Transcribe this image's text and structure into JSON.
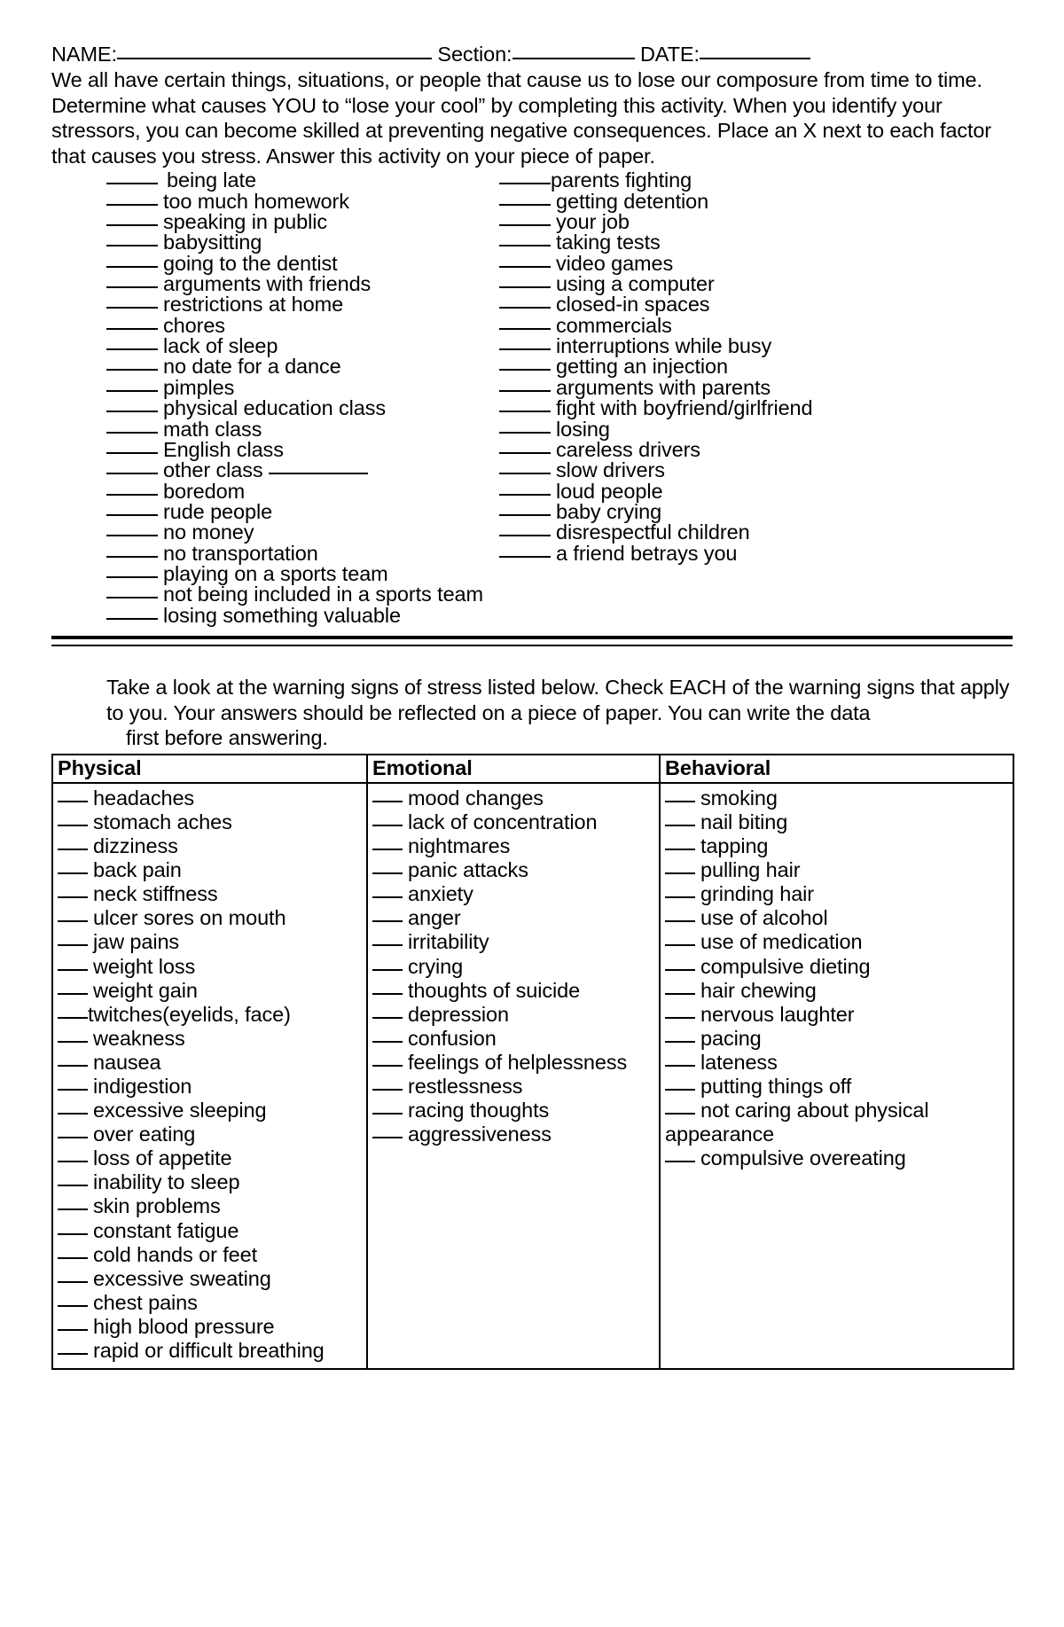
{
  "header": {
    "name_label": "NAME:",
    "section_label": "Section:",
    "date_label": "DATE:"
  },
  "intro": {
    "paragraph": "We all have certain things, situations, or people that cause us to lose our composure from time to time. Determine what causes YOU to “lose your cool” by completing this activity. When you identify your stressors, you can become skilled at preventing negative consequences. Place an X next to each factor that causes you stress. Answer this activity on your piece of paper."
  },
  "stressors": {
    "left_column": [
      "being late",
      "too much homework",
      "speaking in public",
      "babysitting",
      "going to the dentist",
      "arguments with friends",
      "restrictions at home",
      "chores",
      "lack of sleep",
      "no date for a dance",
      "pimples",
      "physical education class",
      "math class",
      "English class",
      "other class",
      "boredom",
      "rude people",
      "no money",
      "no transportation",
      "playing on a sports team",
      "not being included in a sports team",
      "losing something valuable"
    ],
    "right_column": [
      "parents fighting",
      "getting detention",
      "your job",
      "taking tests",
      "video games",
      "using a computer",
      "closed-in spaces",
      "commercials",
      "interruptions while busy",
      "getting an injection",
      "arguments with parents",
      "fight with boyfriend/girlfriend",
      "losing",
      "careless drivers",
      "slow drivers",
      "loud people",
      "baby crying",
      "disrespectful children",
      "a friend betrays you"
    ]
  },
  "warning_signs": {
    "instructions_line1": "Take a look at the warning signs of stress listed below. Check EACH of the warning signs that",
    "instructions_line2": "apply to you. Your answers should be reflected on a piece of paper. You can write the data",
    "instructions_line3": "first before answering.",
    "columns": [
      {
        "header": "Physical",
        "items": [
          "headaches",
          "stomach aches",
          "dizziness",
          "back pain",
          "neck stiffness",
          "ulcer sores on mouth",
          "jaw pains",
          "weight loss",
          "weight gain",
          "twitches(eyelids, face)",
          "weakness",
          "nausea",
          "indigestion",
          "excessive sleeping",
          "over eating",
          "loss of appetite",
          "inability to sleep",
          "skin problems",
          "constant fatigue",
          "cold hands or feet",
          "excessive sweating",
          "chest pains",
          "high blood pressure",
          "rapid or difficult breathing"
        ]
      },
      {
        "header": "Emotional",
        "items": [
          "mood changes",
          "lack of concentration",
          "nightmares",
          "panic attacks",
          "anxiety",
          "anger",
          "irritability",
          "crying",
          "thoughts of suicide",
          "depression",
          "confusion",
          "feelings of helplessness",
          "restlessness",
          "racing thoughts",
          "aggressiveness"
        ]
      },
      {
        "header": "Behavioral",
        "items": [
          "smoking",
          "nail biting",
          "tapping",
          "pulling hair",
          "grinding hair",
          "use of alcohol",
          "use of medication",
          "compulsive dieting",
          "hair chewing",
          "nervous laughter",
          "pacing",
          "lateness",
          "putting things off",
          "not caring about physical appearance",
          "compulsive overeating"
        ]
      }
    ]
  },
  "colors": {
    "ink": "#000000",
    "paper": "#ffffff"
  }
}
